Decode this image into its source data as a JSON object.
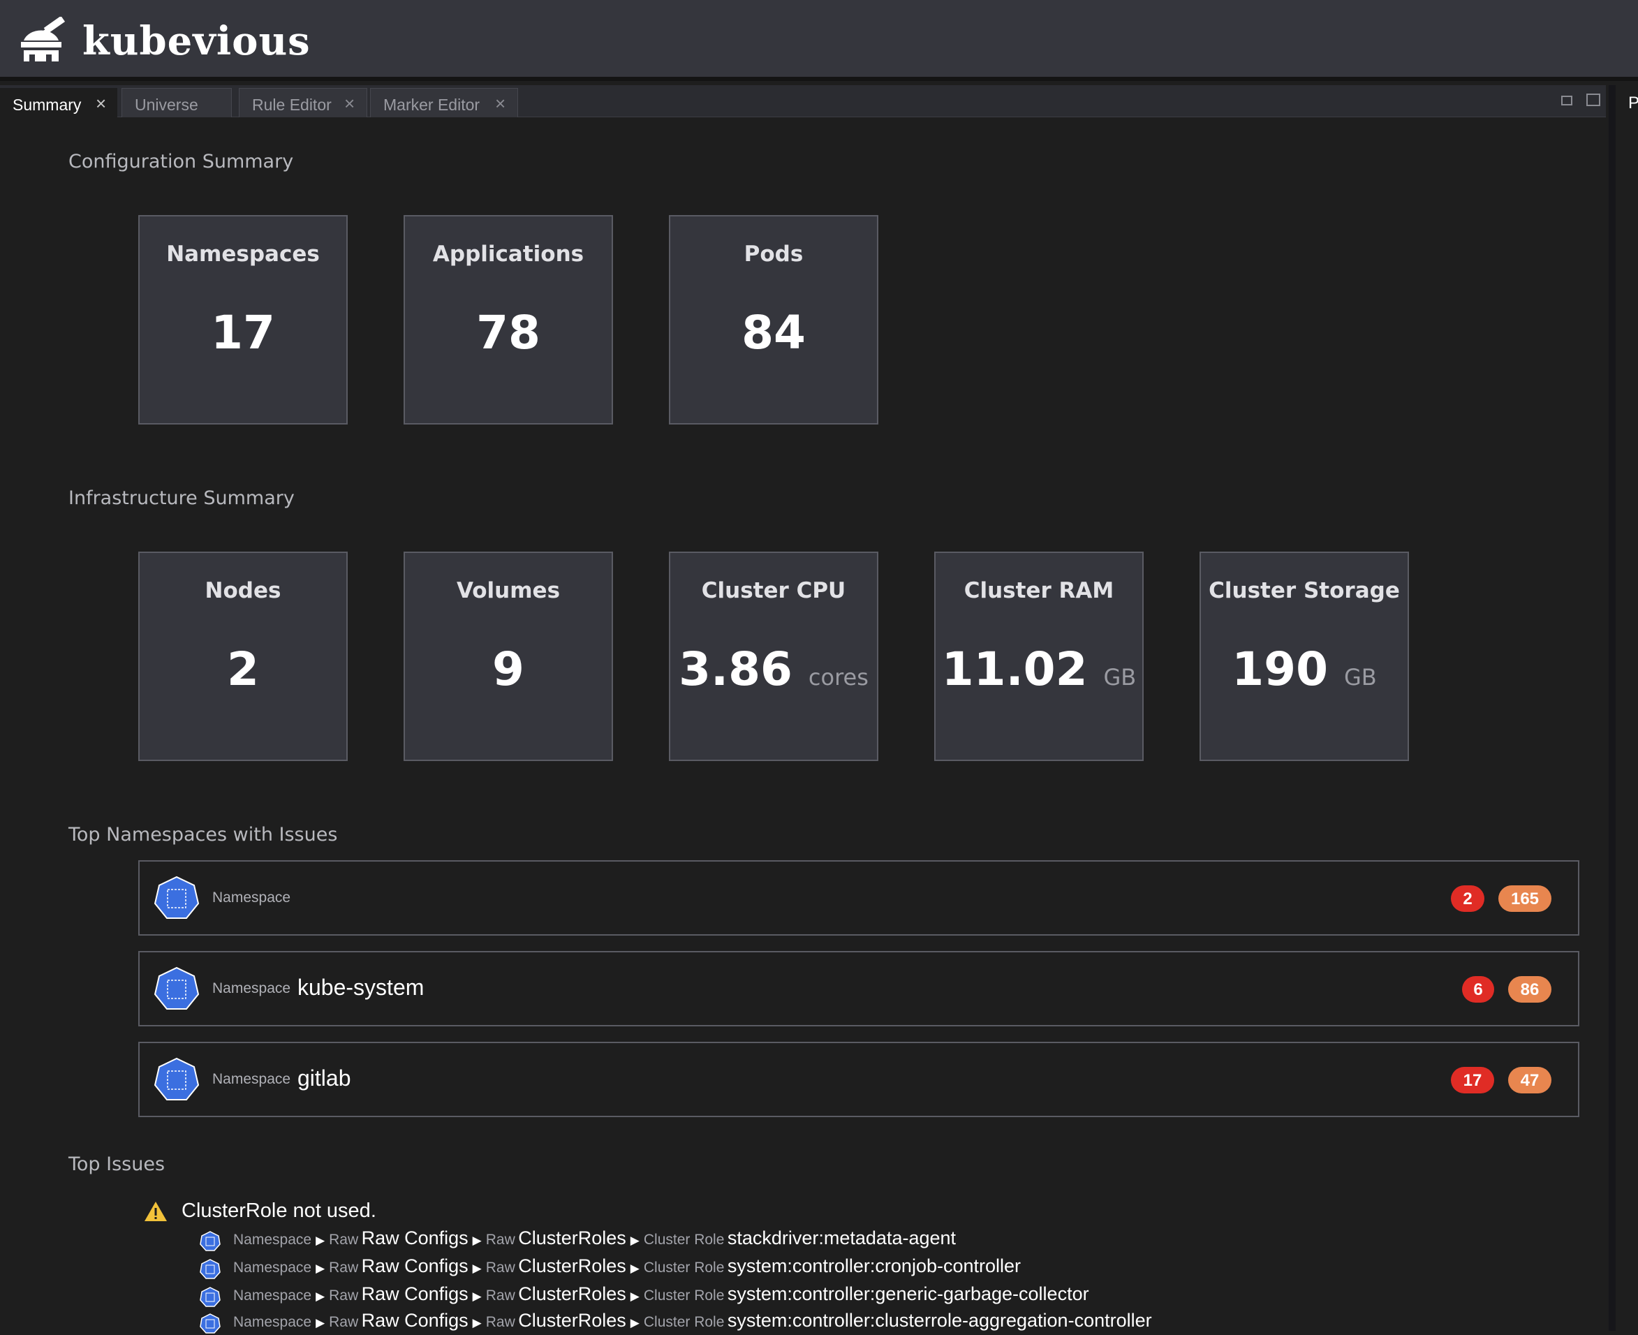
{
  "app": {
    "name": "kubevious"
  },
  "tabs": [
    {
      "label": "Summary",
      "active": true,
      "closable": true
    },
    {
      "label": "Universe",
      "active": false,
      "closable": false
    },
    {
      "label": "Rule Editor",
      "active": false,
      "closable": true
    },
    {
      "label": "Marker Editor",
      "active": false,
      "closable": true
    }
  ],
  "right_panel_letter": "P",
  "configuration_summary": {
    "title": "Configuration Summary",
    "cards": [
      {
        "title": "Namespaces",
        "value": "17",
        "unit": ""
      },
      {
        "title": "Applications",
        "value": "78",
        "unit": ""
      },
      {
        "title": "Pods",
        "value": "84",
        "unit": ""
      }
    ]
  },
  "infrastructure_summary": {
    "title": "Infrastructure Summary",
    "cards": [
      {
        "title": "Nodes",
        "value": "2",
        "unit": ""
      },
      {
        "title": "Volumes",
        "value": "9",
        "unit": ""
      },
      {
        "title": "Cluster CPU",
        "value": "3.86",
        "unit": "cores"
      },
      {
        "title": "Cluster RAM",
        "value": "11.02",
        "unit": "GB"
      },
      {
        "title": "Cluster Storage",
        "value": "190",
        "unit": "GB"
      }
    ]
  },
  "top_namespaces": {
    "title": "Top Namespaces with Issues",
    "rows": [
      {
        "kind": "Namespace",
        "name": "",
        "errors": "2",
        "warnings": "165"
      },
      {
        "kind": "Namespace",
        "name": "kube-system",
        "errors": "6",
        "warnings": "86"
      },
      {
        "kind": "Namespace",
        "name": "gitlab",
        "errors": "17",
        "warnings": "47"
      }
    ]
  },
  "top_issues": {
    "title": "Top Issues",
    "issue": {
      "message": "ClusterRole not used.",
      "paths": [
        {
          "ns_kind": "Namespace",
          "raw1_kind": "Raw",
          "raw1_name": "Raw Configs",
          "raw2_kind": "Raw",
          "raw2_name": "ClusterRoles",
          "role_kind": "Cluster Role",
          "role_name": "stackdriver:metadata-agent"
        },
        {
          "ns_kind": "Namespace",
          "raw1_kind": "Raw",
          "raw1_name": "Raw Configs",
          "raw2_kind": "Raw",
          "raw2_name": "ClusterRoles",
          "role_kind": "Cluster Role",
          "role_name": "system:controller:cronjob-controller"
        },
        {
          "ns_kind": "Namespace",
          "raw1_kind": "Raw",
          "raw1_name": "Raw Configs",
          "raw2_kind": "Raw",
          "raw2_name": "ClusterRoles",
          "role_kind": "Cluster Role",
          "role_name": "system:controller:generic-garbage-collector"
        },
        {
          "ns_kind": "Namespace",
          "raw1_kind": "Raw",
          "raw1_name": "Raw Configs",
          "raw2_kind": "Raw",
          "raw2_name": "ClusterRoles",
          "role_kind": "Cluster Role",
          "role_name": "system:controller:clusterrole-aggregation-controller"
        }
      ]
    }
  },
  "colors": {
    "error": "#e02c25",
    "warning": "#e8864f",
    "namespace_icon": "#3b6fe0"
  }
}
